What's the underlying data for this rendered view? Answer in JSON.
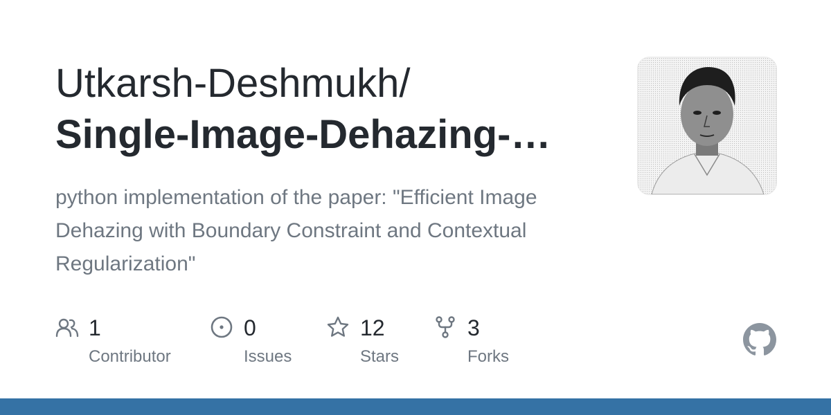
{
  "repo": {
    "owner": "Utkarsh-Deshmukh/",
    "name": "Single-Image-Dehazing-…",
    "description": "python implementation of the paper: \"Efficient Image Dehazing with Boundary Constraint and Contextual Regularization\""
  },
  "stats": {
    "contributors": {
      "value": "1",
      "label": "Contributor",
      "icon": "people-icon"
    },
    "issues": {
      "value": "0",
      "label": "Issues",
      "icon": "issue-opened-icon"
    },
    "stars": {
      "value": "12",
      "label": "Stars",
      "icon": "star-icon"
    },
    "forks": {
      "value": "3",
      "label": "Forks",
      "icon": "repo-forked-icon"
    }
  },
  "colors": {
    "text_primary": "#24292f",
    "text_secondary": "#6e7781",
    "icon": "#6e7781",
    "github_logo": "#8c959f",
    "bottom_bar": "#3572a5"
  },
  "branding": {
    "logo": "github-mark-icon"
  }
}
